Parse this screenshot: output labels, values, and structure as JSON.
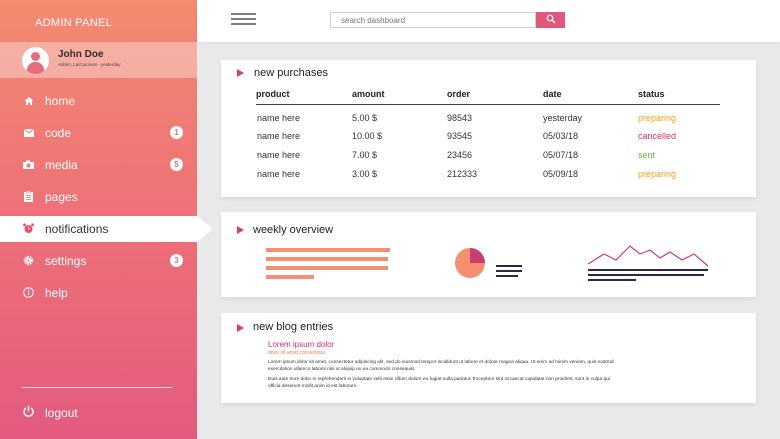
{
  "sidebar": {
    "brand": "ADMIN PANEL",
    "profile": {
      "name": "John Doe",
      "subtitle": "Admin, Last access - yesterday"
    },
    "items": [
      {
        "label": "home",
        "icon": "home-icon",
        "badge": ""
      },
      {
        "label": "code",
        "icon": "envelope-icon",
        "badge": "1"
      },
      {
        "label": "media",
        "icon": "camera-icon",
        "badge": "5"
      },
      {
        "label": "pages",
        "icon": "clipboard-icon",
        "badge": ""
      },
      {
        "label": "notifications",
        "icon": "alarm-icon",
        "badge": ""
      },
      {
        "label": "settings",
        "icon": "gear-icon",
        "badge": "3"
      },
      {
        "label": "help",
        "icon": "info-icon",
        "badge": ""
      }
    ],
    "active_item": "notifications",
    "logout": "logout"
  },
  "topbar": {
    "search_placeholder": "search dashboard"
  },
  "purchases": {
    "title": "new purchases",
    "columns": [
      "product",
      "amount",
      "order",
      "date",
      "status"
    ],
    "rows": [
      [
        "name here",
        "5.00 $",
        "98543",
        "yesterday",
        "preparing"
      ],
      [
        "name here",
        "10.00 $",
        "93545",
        "05/03/18",
        "cancelled"
      ],
      [
        "name here",
        "7.00 $",
        "23456",
        "05/07/18",
        "sent"
      ],
      [
        "name here",
        "3.00 $",
        "212333",
        "05/09/18",
        "preparing"
      ]
    ]
  },
  "overview": {
    "title": "weekly overview"
  },
  "blog": {
    "title": "new blog entries",
    "entry_title": "Lorem ipsum dolor",
    "entry_subtitle": "dolor sit amet consectetur",
    "paragraph1": "Lorem ipsum dolor sit amet, consectetur adipiscing elit, sed do eiusmod tempor incididunt ut labore et dolore magna aliqua. Ut enim ad minim veniam, quis nostrud exercitation ullamco laboris nisi ut aliquip ex ea commodo consequat.",
    "paragraph2": "Duis aute irure dolor in reprehenderit in voluptate velit esse cillum dolore eu fugiat nulla pariatur. Excepteur sint occaecat cupidatat non proident, sunt in culpa qui officia deserunt mollit anim id est laborum."
  },
  "colors": {
    "accent": "#e1577a",
    "sidebar_top": "#f48a70",
    "sidebar_bottom": "#e35a7f",
    "status_preparing": "#f0a21a",
    "status_cancelled": "#d8306b",
    "status_sent": "#6fb63a"
  }
}
